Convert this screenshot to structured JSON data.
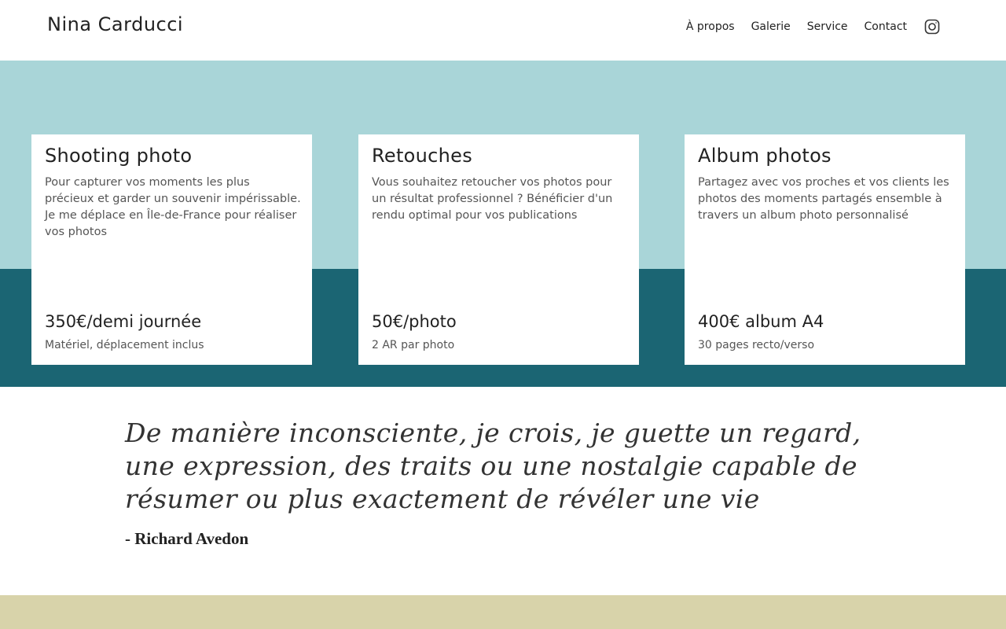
{
  "header": {
    "brand": "Nina Carducci",
    "nav": [
      {
        "label": "À propos"
      },
      {
        "label": "Galerie"
      },
      {
        "label": "Service"
      },
      {
        "label": "Contact"
      }
    ],
    "social_icon": "instagram-icon"
  },
  "colors": {
    "band_top": "#a9d5d8",
    "band_bottom": "#1b6573",
    "footer_band": "#d8d3aa",
    "card_bg": "#ffffff"
  },
  "services": [
    {
      "title": "Shooting photo",
      "description": "Pour capturer vos moments les plus précieux et garder un souvenir impérissable. Je me déplace en Île-de-France pour réaliser vos photos",
      "price": "350€/demi journée",
      "note": "Matériel, déplacement inclus"
    },
    {
      "title": "Retouches",
      "description": "Vous souhaitez retoucher vos photos pour un résultat professionnel ? Bénéficier d'un rendu optimal pour vos publications",
      "price": "50€/photo",
      "note": "2 AR par photo"
    },
    {
      "title": "Album photos",
      "description": "Partagez avec vos proches et vos clients les photos des moments partagés ensemble à travers un album photo personnalisé",
      "price": "400€ album A4",
      "note": "30 pages recto/verso"
    }
  ],
  "quote": {
    "text": "De manière inconsciente, je crois, je guette un regard, une expression, des traits ou une nostalgie capable de résumer ou plus exactement de révéler une vie",
    "author": "- Richard Avedon"
  }
}
